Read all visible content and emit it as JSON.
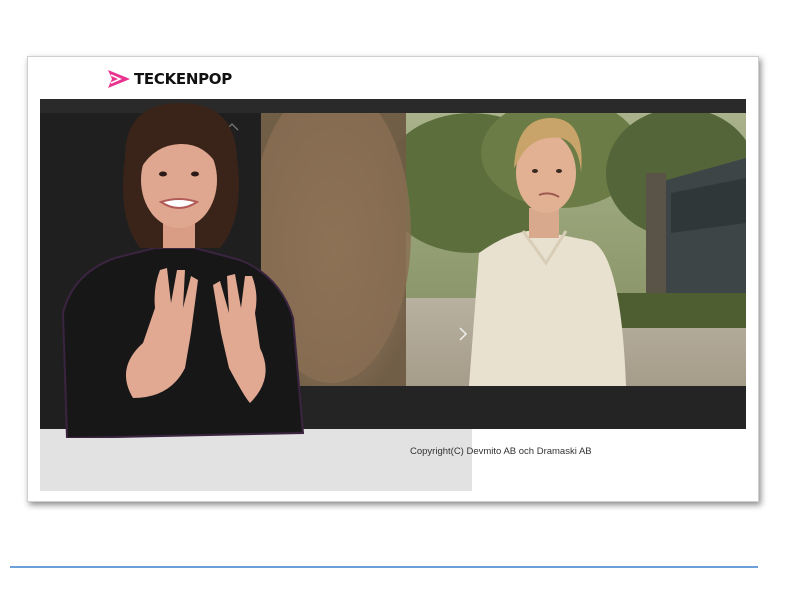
{
  "brand": {
    "name": "TECKENPOP",
    "accent_color": "#e8348f",
    "icon": "play-logo-icon"
  },
  "player": {
    "background_color": "#222222",
    "scroll_up_icon": "chevron-up-icon",
    "next_icon": "chevron-right-icon"
  },
  "video": {
    "description_icon": "video-frame"
  },
  "interpreter": {
    "icon": "sign-language-interpreter"
  },
  "footer": {
    "copyright": "Copyright(C) Devmito AB och Dramaski AB"
  },
  "divider_color": "#6a9fd8"
}
